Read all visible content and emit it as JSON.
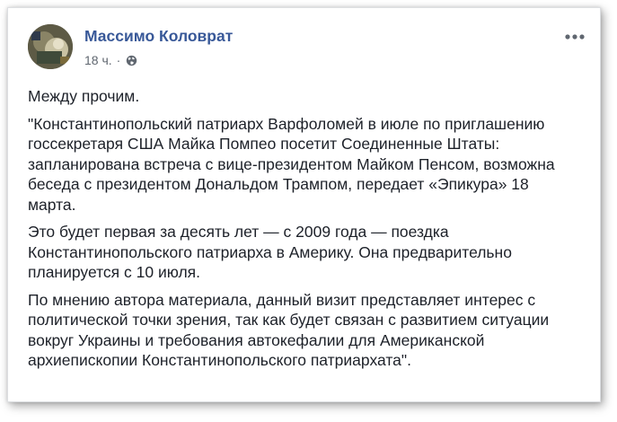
{
  "post": {
    "author": "Массимо Коловрат",
    "time": "18 ч.",
    "separator": "·",
    "privacy_icon": "globe-icon",
    "more_icon": "more-options-icon",
    "paragraphs": [
      "Между прочим.",
      "\"Константинопольский патриарх Варфоломей в июле по приглашению\nгоссекретаря США Майка Помпео посетит Соединенные Штаты:\nзапланирована встреча с вице-президентом Майком Пенсом, возможна\nбеседа с президентом Дональдом Трампом, передает «Эпикура» 18\nмарта.",
      "Это будет первая за десять лет — с 2009 года — поездка\nКонстантинопольского патриарха в Америку. Она предварительно\nпланируется с 10 июля.",
      "По мнению автора материала, данный визит представляет интерес с\nполитической точки зрения, так как будет связан с развитием ситуации\nвокруг Украины и требования автокефалии для Американской\nархиепископии Константинопольского патриархата\"."
    ]
  },
  "colors": {
    "author_link": "#385898",
    "meta_text": "#606770",
    "body_text": "#1d2129"
  }
}
